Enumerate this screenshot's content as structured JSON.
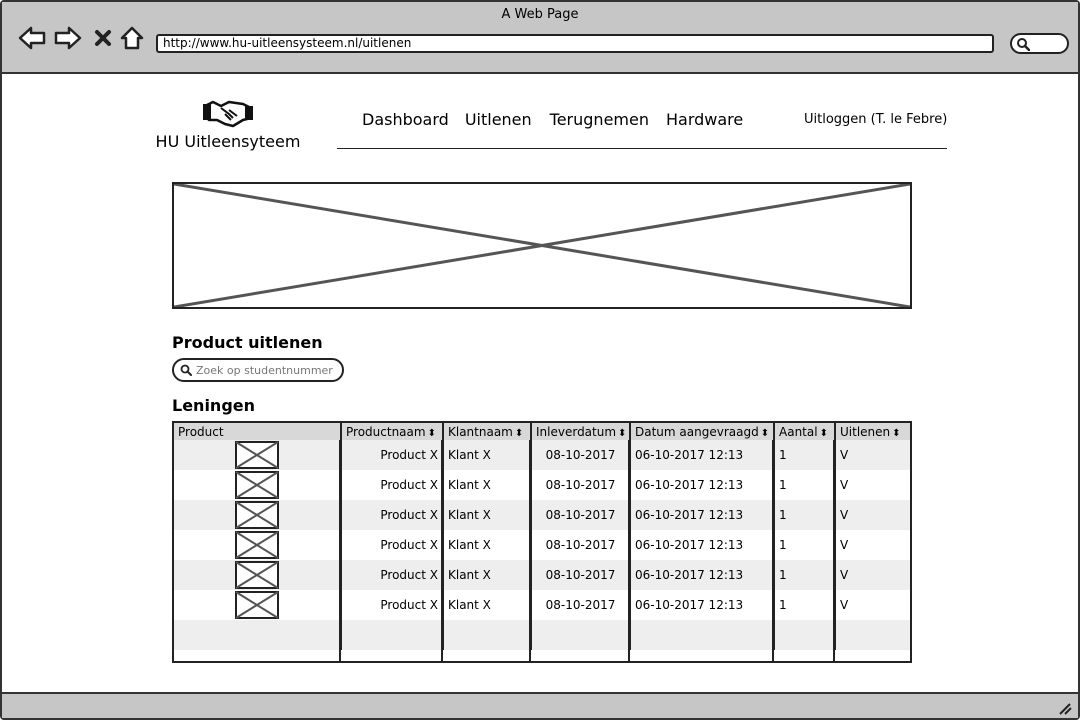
{
  "window": {
    "title": "A Web Page",
    "url": "http://www.hu-uitleensysteem.nl/uitlenen"
  },
  "header": {
    "logo_icon": "handshake-icon",
    "app_name": "HU Uitleensyteem",
    "nav": [
      "Dashboard",
      "Uitlenen",
      "Terugnemen",
      "Hardware"
    ],
    "logout": "Uitloggen (T. le Febre)"
  },
  "banner": {
    "type": "image-placeholder"
  },
  "lend": {
    "title": "Product uitlenen",
    "search_placeholder": "Zoek op studentnummer"
  },
  "loans": {
    "title": "Leningen",
    "columns": [
      "Product",
      "Productnaam",
      "Klantnaam",
      "Inleverdatum",
      "Datum aangevraagd",
      "Aantal",
      "Uitlenen"
    ],
    "rows": [
      {
        "productnaam": "Product X",
        "klantnaam": "Klant X",
        "inleverdatum": "08-10-2017",
        "datum_aangevraagd": "06-10-2017 12:13",
        "aantal": "1",
        "uitlenen": "V"
      },
      {
        "productnaam": "Product X",
        "klantnaam": "Klant X",
        "inleverdatum": "08-10-2017",
        "datum_aangevraagd": "06-10-2017 12:13",
        "aantal": "1",
        "uitlenen": "V"
      },
      {
        "productnaam": "Product X",
        "klantnaam": "Klant X",
        "inleverdatum": "08-10-2017",
        "datum_aangevraagd": "06-10-2017 12:13",
        "aantal": "1",
        "uitlenen": "V"
      },
      {
        "productnaam": "Product X",
        "klantnaam": "Klant X",
        "inleverdatum": "08-10-2017",
        "datum_aangevraagd": "06-10-2017 12:13",
        "aantal": "1",
        "uitlenen": "V"
      },
      {
        "productnaam": "Product X",
        "klantnaam": "Klant X",
        "inleverdatum": "08-10-2017",
        "datum_aangevraagd": "06-10-2017 12:13",
        "aantal": "1",
        "uitlenen": "V"
      },
      {
        "productnaam": "Product X",
        "klantnaam": "Klant X",
        "inleverdatum": "08-10-2017",
        "datum_aangevraagd": "06-10-2017 12:13",
        "aantal": "1",
        "uitlenen": "V"
      }
    ]
  }
}
